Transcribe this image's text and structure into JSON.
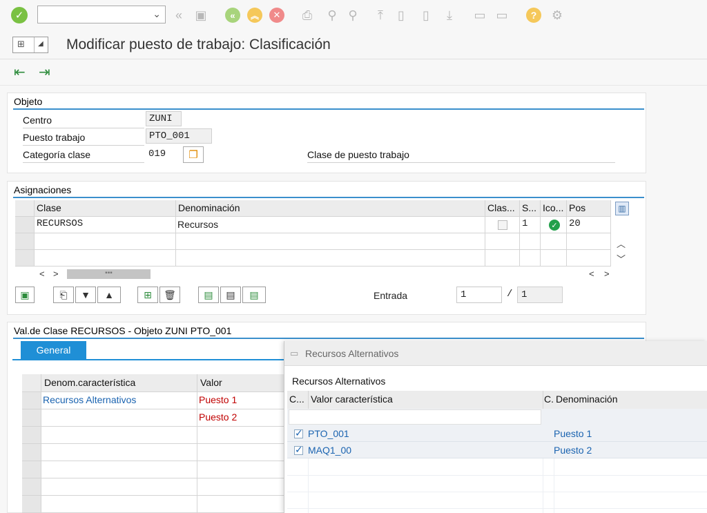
{
  "toolbar": {
    "command_field_value": "",
    "icons": [
      "enter-icon",
      "back-icon",
      "save-icon",
      "back-green-icon",
      "exit-icon",
      "cancel-icon",
      "print-icon",
      "find-icon",
      "find-next-icon",
      "first-page-icon",
      "prev-page-icon",
      "next-page-icon",
      "last-page-icon",
      "new-session-icon",
      "shortcut-icon",
      "help-icon",
      "settings-icon"
    ]
  },
  "title": "Modificar puesto de trabajo: Clasificación",
  "objeto": {
    "section_title": "Objeto",
    "centro_label": "Centro",
    "centro_value": "ZUNI",
    "puesto_label": "Puesto trabajo",
    "puesto_value": "PTO_001",
    "categoria_label": "Categoría clase",
    "categoria_value": "019",
    "clase_puesto_label": "Clase de puesto trabajo"
  },
  "asignaciones": {
    "section_title": "Asignaciones",
    "columns": [
      "Clase",
      "Denominación",
      "Clas...",
      "S...",
      "Ico...",
      "Pos"
    ],
    "rows": [
      {
        "clase": "RECURSOS",
        "denominacion": "Recursos",
        "clas": false,
        "s": "1",
        "ico": "green-check-icon",
        "pos": "20"
      }
    ],
    "nav_left": "<",
    "nav_right": ">",
    "entrada_label": "Entrada",
    "entrada_value": "1",
    "entrada_sep": "/",
    "entrada_total": "1"
  },
  "valclase": {
    "section_title": "Val.de Clase RECURSOS - Objeto ZUNI PTO_001",
    "tab_general": "General",
    "columns": [
      "Denom.característica",
      "Valor"
    ],
    "rows": [
      {
        "denom": "Recursos Alternativos",
        "valor": "Puesto 1"
      },
      {
        "denom": "",
        "valor": "Puesto 2"
      }
    ]
  },
  "popup": {
    "window_title": "Recursos Alternativos",
    "subtitle": "Recursos Alternativos",
    "columns": [
      "C...",
      "Valor característica",
      "C.",
      "Denominación"
    ],
    "rows": [
      {
        "checked": true,
        "valor": "PTO_001",
        "denominacion": "Puesto 1"
      },
      {
        "checked": true,
        "valor": "MAQ1_00",
        "denominacion": "Puesto 2"
      }
    ]
  },
  "colors": {
    "accent": "#1f8fd6",
    "link_blue": "#1a63b0",
    "value_red": "#c00000",
    "ok_green": "#22a04b"
  }
}
